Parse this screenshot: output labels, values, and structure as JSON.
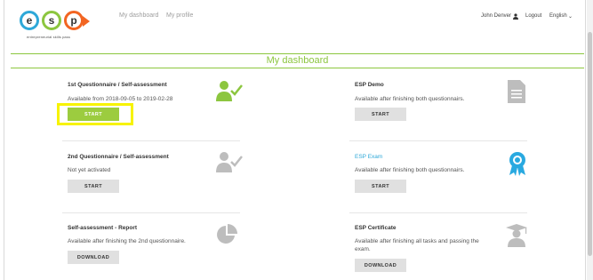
{
  "header": {
    "logo": {
      "letters": [
        "e",
        "s",
        "p"
      ],
      "tagline": "entrepreneurial skills pass"
    },
    "nav": {
      "dashboard": "My dashboard",
      "profile": "My profile"
    },
    "user": {
      "name": "John Denver",
      "icon": "user-icon",
      "logout": "Logout",
      "language": "English",
      "language_icon": "chevron-down-icon"
    }
  },
  "page": {
    "title": "My dashboard",
    "accent": "#8cc63f"
  },
  "cards": {
    "q1": {
      "title": "1st Questionnaire / Self-assessment",
      "text": "Available from 2018-09-05 to 2019-02-28",
      "button": "START",
      "icon": "user-check-icon"
    },
    "q2": {
      "title": "2nd Questionnaire / Self-assessment",
      "text": "Not yet activated",
      "button": "START",
      "icon": "user-check-icon"
    },
    "report": {
      "title": "Self-assessment - Report",
      "text": "Available after finishing the 2nd questionnaire.",
      "button": "DOWNLOAD",
      "icon": "pie-chart-icon"
    },
    "demo": {
      "title": "ESP Demo",
      "text": "Available after finishing both questionnairs.",
      "button": "START",
      "icon": "document-icon"
    },
    "exam": {
      "title": "ESP Exam",
      "text": "Available after finishing both questionnairs.",
      "button": "START",
      "icon": "award-ribbon-icon"
    },
    "certificate": {
      "title": "ESP Certificate",
      "text_line1": "Available after finishing all tasks and passing the",
      "text_line2": "exam.",
      "button": "DOWNLOAD",
      "icon": "graduate-icon"
    }
  }
}
